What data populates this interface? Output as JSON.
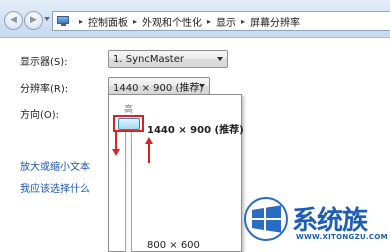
{
  "header": {
    "breadcrumbs": [
      "控制面板",
      "外观和个性化",
      "显示",
      "屏幕分辨率"
    ],
    "separator": "▸"
  },
  "settings": {
    "display_label": "显示器(S):",
    "display_value": "1. SyncMaster",
    "resolution_label": "分辨率(R):",
    "resolution_value": "1440 × 900 (推荐)",
    "orientation_label": "方向(O):"
  },
  "popup": {
    "high_label": "高",
    "current_label": "1440 × 900 (推荐)",
    "low_label": "800 × 600",
    "slider_level": 1.0
  },
  "links": {
    "enlarge_text": "放大或缩小文本",
    "which_settings": "我应该选择什么"
  },
  "watermark": {
    "title": "系统族",
    "url": "WWW.XITONGZU.COM"
  },
  "colors": {
    "link": "#1a55b8",
    "annotation": "#e02020",
    "header_gradient_top": "#e4eef9",
    "watermark": "#1d5db3"
  }
}
